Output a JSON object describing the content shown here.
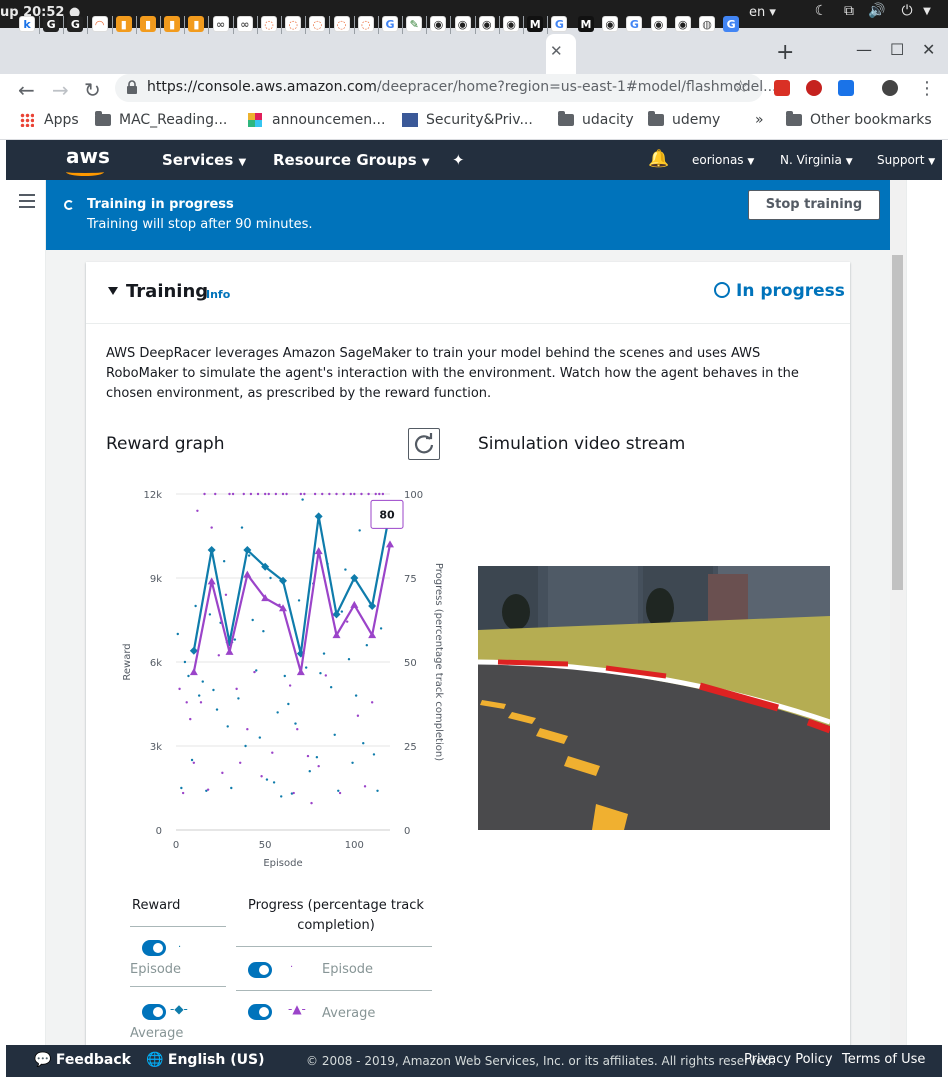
{
  "os": {
    "clock": "up 20:52 ●",
    "lang": "en ▾"
  },
  "browser": {
    "url_host": "https://console.aws.amazon.com",
    "url_path": "/deepracer/home?region=us-east-1#model/flashmodel...",
    "bookmarks": [
      "Apps",
      "MAC_Reading...",
      "announcemen...",
      "Security&Priv...",
      "udacity",
      "udemy",
      "»",
      "Other bookmarks"
    ]
  },
  "aws_nav": {
    "logo": "aws",
    "services": "Services",
    "resource_groups": "Resource Groups",
    "user": "eorionas",
    "region": "N. Virginia",
    "support": "Support"
  },
  "flash": {
    "title": "Training in progress",
    "message": "Training will stop after 90 minutes.",
    "stop_button": "Stop training"
  },
  "card": {
    "title": "Training",
    "info_link": "Info",
    "status": "In progress",
    "description": "AWS DeepRacer leverages Amazon SageMaker to train your model behind the scenes and uses AWS RoboMaker to simulate the agent's interaction with the environment. Watch how the agent behaves in the chosen environment, as prescribed by the reward function.",
    "reward_graph_title": "Reward graph",
    "video_title": "Simulation video stream",
    "tooltip_value": "80"
  },
  "legend": {
    "reward_header": "Reward",
    "progress_header": "Progress (percentage track completion)",
    "episode_label": "Episode",
    "average_label": "Average",
    "episode_label_2": "Episode",
    "average_label_2": "Average"
  },
  "footer": {
    "feedback": "Feedback",
    "language": "English (US)",
    "copyright": "© 2008 - 2019, Amazon Web Services, Inc. or its affiliates. All rights reserved.",
    "privacy": "Privacy Policy",
    "terms": "Terms of Use"
  },
  "chart_data": {
    "type": "line",
    "xlabel": "Episode",
    "ylabel": "Reward",
    "y2label": "Progress (percentage track completion)",
    "xlim": [
      0,
      120
    ],
    "ylim": [
      0,
      12000
    ],
    "y2lim": [
      0,
      100
    ],
    "xticks": [
      "0",
      "50",
      "100"
    ],
    "yticks": [
      "0",
      "3k",
      "6k",
      "9k",
      "12k"
    ],
    "y2ticks": [
      "0",
      "25",
      "50",
      "75",
      "100"
    ],
    "series": [
      {
        "name": "Reward Average",
        "axis": "left",
        "color": "#0f7cab",
        "marker": "diamond",
        "x": [
          10,
          20,
          30,
          40,
          50,
          60,
          70,
          80,
          90,
          100,
          110,
          120
        ],
        "y": [
          6400,
          10000,
          6700,
          10000,
          9400,
          8900,
          6300,
          11200,
          7700,
          9000,
          8000,
          11400
        ]
      },
      {
        "name": "Progress Average",
        "axis": "right",
        "color": "#9b44c9",
        "marker": "triangle",
        "x": [
          10,
          20,
          30,
          40,
          50,
          60,
          70,
          80,
          90,
          100,
          110,
          120
        ],
        "y": [
          47,
          74,
          53,
          76,
          69,
          66,
          47,
          83,
          58,
          67,
          58,
          85
        ]
      }
    ],
    "scatter_reward": {
      "color": "#0f7cab",
      "x": [
        1,
        3,
        5,
        7,
        9,
        11,
        13,
        15,
        17,
        19,
        21,
        23,
        25,
        27,
        29,
        31,
        33,
        35,
        37,
        39,
        41,
        43,
        45,
        47,
        49,
        51,
        53,
        55,
        57,
        59,
        61,
        63,
        65,
        67,
        69,
        71,
        73,
        75,
        77,
        79,
        81,
        83,
        85,
        87,
        89,
        91,
        93,
        95,
        97,
        99,
        101,
        103,
        105,
        107,
        109,
        111,
        113,
        115
      ],
      "y": [
        7000,
        1500,
        6000,
        5500,
        2500,
        8000,
        4800,
        5300,
        1400,
        7700,
        5000,
        4300,
        7400,
        9600,
        3700,
        1500,
        6800,
        4700,
        10800,
        3000,
        9800,
        7500,
        5700,
        3300,
        7100,
        1800,
        9000,
        1700,
        4200,
        1200,
        5500,
        4500,
        1300,
        3800,
        8200,
        11800,
        5800,
        2100,
        8800,
        2600,
        5600,
        6300,
        9500,
        5100,
        3400,
        1400,
        7800,
        9300,
        6100,
        2400,
        4800,
        10700,
        3100,
        6600,
        8100,
        2700,
        1400,
        7200
      ]
    },
    "scatter_progress": {
      "color": "#9b44c9",
      "x": [
        2,
        4,
        6,
        8,
        10,
        12,
        14,
        16,
        18,
        20,
        22,
        24,
        26,
        28,
        30,
        32,
        34,
        36,
        38,
        40,
        42,
        44,
        46,
        48,
        50,
        52,
        54,
        56,
        58,
        60,
        62,
        64,
        66,
        68,
        70,
        72,
        74,
        76,
        78,
        80,
        82,
        84,
        86,
        88,
        90,
        92,
        94,
        96,
        98,
        100,
        102,
        104,
        106,
        108,
        110,
        112,
        114,
        116
      ],
      "y": [
        42,
        11,
        38,
        33,
        20,
        95,
        38,
        100,
        12,
        90,
        100,
        52,
        17,
        70,
        100,
        100,
        42,
        20,
        100,
        30,
        100,
        47,
        100,
        16,
        100,
        100,
        23,
        100,
        67,
        100,
        100,
        43,
        11,
        30,
        100,
        100,
        22,
        8,
        100,
        19,
        100,
        46,
        100,
        64,
        100,
        11,
        100,
        62,
        100,
        100,
        34,
        100,
        13,
        100,
        38,
        100,
        100,
        100
      ]
    }
  }
}
